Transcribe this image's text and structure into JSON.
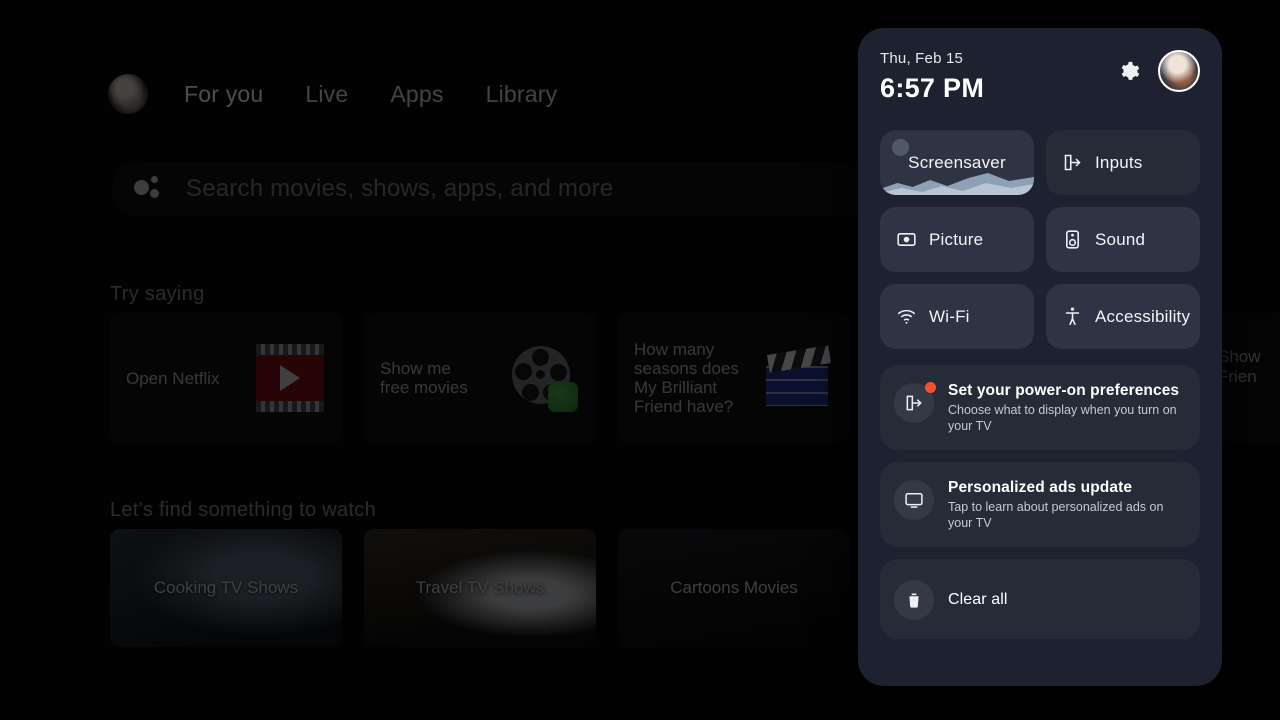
{
  "home": {
    "nav": {
      "avatar_name": "profile-avatar",
      "items": [
        {
          "label": "For you",
          "selected": true
        },
        {
          "label": "Live",
          "selected": false
        },
        {
          "label": "Apps",
          "selected": false
        },
        {
          "label": "Library",
          "selected": false
        }
      ]
    },
    "search": {
      "icon": "google-assistant-icon",
      "placeholder": "Search movies, shows, apps, and more",
      "value": ""
    },
    "try_saying": {
      "title": "Try saying",
      "cards": [
        {
          "label": "Open Netflix",
          "art": "film-frame-icon"
        },
        {
          "label": "Show me\nfree movies",
          "art": "film-reel-icon"
        },
        {
          "label": "How many\nseasons does\nMy Brilliant\nFriend have?",
          "art": "clapperboard-icon"
        }
      ],
      "edge_card": {
        "label": "Show\nFrien"
      }
    },
    "find_something": {
      "title": "Let's find something to watch",
      "cards": [
        {
          "label": "Cooking TV Shows"
        },
        {
          "label": "Travel TV Shows"
        },
        {
          "label": "Cartoons Movies"
        }
      ]
    }
  },
  "quick_settings": {
    "date": "Thu, Feb 15",
    "time": "6:57 PM",
    "settings_icon": "gear-icon",
    "avatar": "account-avatar",
    "accent_badge_color": "#f2532e",
    "panel_color": "#1e2230",
    "tile_color": "#2e3443",
    "tiles": [
      {
        "label": "Screensaver",
        "icon": "screensaver-landscape-icon",
        "focused": true
      },
      {
        "label": "Inputs",
        "icon": "inputs-icon",
        "focused": false
      },
      {
        "label": "Picture",
        "icon": "picture-icon",
        "focused": false
      },
      {
        "label": "Sound",
        "icon": "sound-speaker-icon",
        "focused": false
      },
      {
        "label": "Wi-Fi",
        "icon": "wifi-icon",
        "focused": false
      },
      {
        "label": "Accessibility",
        "icon": "accessibility-icon",
        "focused": false
      }
    ],
    "notifications": [
      {
        "title": "Set your power-on preferences",
        "body": "Choose what to display when you turn on your TV",
        "icon": "inputs-icon",
        "has_badge": true
      },
      {
        "title": "Personalized ads update",
        "body": "Tap to learn about personalized ads on your TV",
        "icon": "tv-monitor-icon",
        "has_badge": false
      }
    ],
    "clear_all": {
      "label": "Clear all",
      "icon": "trash-icon"
    }
  }
}
